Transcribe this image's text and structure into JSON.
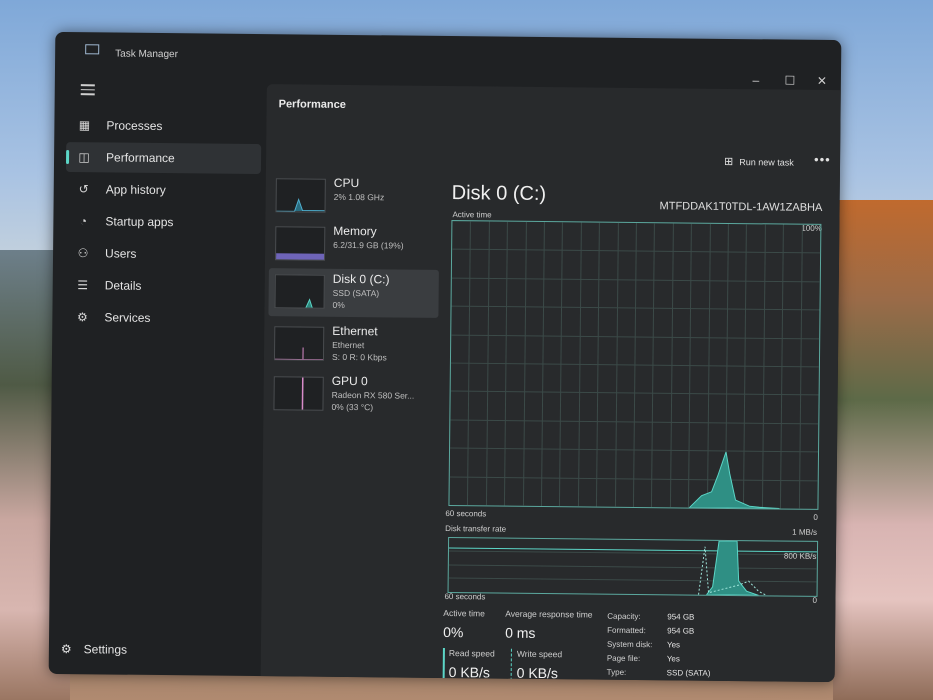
{
  "window": {
    "title": "Task Manager"
  },
  "controls": {
    "minimize": "–",
    "maximize": "☐",
    "close": "✕"
  },
  "sidebar": {
    "items": [
      {
        "label": "Processes",
        "icon": "processes-icon",
        "glyph": "▦"
      },
      {
        "label": "Performance",
        "icon": "performance-icon",
        "glyph": "◫"
      },
      {
        "label": "App history",
        "icon": "app-history-icon",
        "glyph": "↺"
      },
      {
        "label": "Startup apps",
        "icon": "startup-icon",
        "glyph": "◔"
      },
      {
        "label": "Users",
        "icon": "users-icon",
        "glyph": "⚇"
      },
      {
        "label": "Details",
        "icon": "details-icon",
        "glyph": "☰"
      },
      {
        "label": "Services",
        "icon": "services-icon",
        "glyph": "⚙"
      }
    ],
    "settings": {
      "label": "Settings",
      "glyph": "⚙"
    }
  },
  "main": {
    "title": "Performance",
    "run_task": "Run new task",
    "run_task_glyph": "⊞",
    "more": "•••"
  },
  "resources": [
    {
      "name": "CPU",
      "sub1": "2% 1.08 GHz",
      "sub2": ""
    },
    {
      "name": "Memory",
      "sub1": "6.2/31.9 GB (19%)",
      "sub2": ""
    },
    {
      "name": "Disk 0 (C:)",
      "sub1": "SSD (SATA)",
      "sub2": "0%"
    },
    {
      "name": "Ethernet",
      "sub1": "Ethernet",
      "sub2": "S: 0 R: 0 Kbps"
    },
    {
      "name": "GPU 0",
      "sub1": "Radeon RX 580 Ser...",
      "sub2": "0% (33 °C)"
    }
  ],
  "disk": {
    "title": "Disk 0 (C:)",
    "model": "MTFDDAK1T0TDL-1AW1ZABHA",
    "active_time_label": "Active time",
    "max_pct": "100%",
    "seconds_label": "60 seconds",
    "zero": "0",
    "transfer_label": "Disk transfer rate",
    "transfer_max": "1 MB/s",
    "transfer_mid": "800 KB/s",
    "stats": {
      "active_time_label": "Active time",
      "active_time": "0%",
      "avg_resp_label": "Average response time",
      "avg_resp": "0 ms",
      "read_label": "Read speed",
      "read": "0 KB/s",
      "write_label": "Write speed",
      "write": "0 KB/s"
    },
    "props": [
      {
        "k": "Capacity:",
        "v": "954 GB"
      },
      {
        "k": "Formatted:",
        "v": "954 GB"
      },
      {
        "k": "System disk:",
        "v": "Yes"
      },
      {
        "k": "Page file:",
        "v": "Yes"
      },
      {
        "k": "Type:",
        "v": "SSD (SATA)"
      }
    ]
  },
  "colors": {
    "accent": "#5cd6c7",
    "disk_line": "#5ba89e",
    "memory": "#8b7ed8",
    "ethernet": "#d88bc9"
  }
}
